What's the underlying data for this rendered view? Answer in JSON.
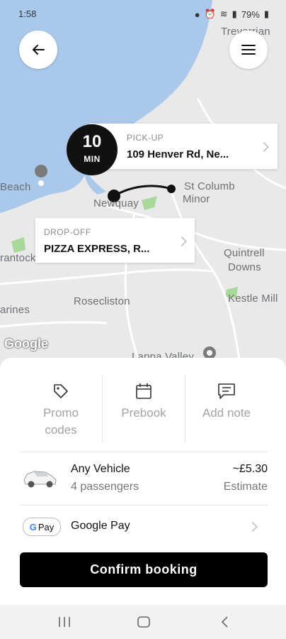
{
  "status_bar": {
    "time": "1:58",
    "battery": "79%"
  },
  "map": {
    "labels": {
      "trevarrian": "Trevarrian",
      "beach": "Beach",
      "newquay": "Newquay",
      "st_columb_minor": "St Columb",
      "st_columb_minor_2": "Minor",
      "quintrell_downs": "Quintrell",
      "quintrell_downs_2": "Downs",
      "crantock": "rantock",
      "rosecliston": "Rosecliston",
      "kestle_mill": "Kestle Mill",
      "carines": "arines",
      "lanes_valley": "Lappa Valley",
      "google": "Google"
    },
    "route_color": "#111111"
  },
  "pickup": {
    "eta_number": "10",
    "eta_unit": "MIN",
    "label": "PICK-UP",
    "address": "109 Henver Rd, Ne..."
  },
  "dropoff": {
    "label": "DROP-OFF",
    "address": "PIZZA EXPRESS, R..."
  },
  "options": [
    {
      "icon": "tag-icon",
      "label_line1": "Promo",
      "label_line2": "codes"
    },
    {
      "icon": "calendar-icon",
      "label_line1": "Prebook",
      "label_line2": ""
    },
    {
      "icon": "note-icon",
      "label_line1": "Add note",
      "label_line2": ""
    }
  ],
  "vehicle": {
    "name": "Any Vehicle",
    "passengers": "4 passengers",
    "price": "~£5.30",
    "price_note": "Estimate"
  },
  "payment": {
    "badge": "Pay",
    "label": "Google Pay"
  },
  "confirm_label": "Confirm booking",
  "colors": {
    "water": "#a9c8ea",
    "land": "#e9e9e9",
    "green": "#a8d89a",
    "accent": "#000000"
  }
}
